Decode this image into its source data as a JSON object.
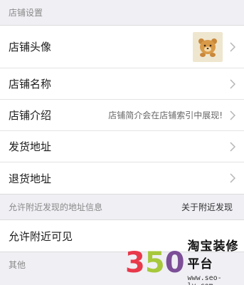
{
  "sections": {
    "store_settings": "店铺设置",
    "nearby_info": "允许附近发现的地址信息",
    "nearby_link": "关于附近发现",
    "other": "其他"
  },
  "rows": {
    "avatar": "店铺头像",
    "name": "店铺名称",
    "intro": "店铺介绍",
    "intro_hint": "店铺简介会在店铺索引中展现!",
    "ship_address": "发货地址",
    "return_address": "退货地址",
    "nearby_visible": "允许附近可见"
  },
  "watermark": {
    "digits": [
      "3",
      "5",
      "0"
    ],
    "title": "淘宝装修平台",
    "url": "www.seo-lv.com"
  },
  "icons": {
    "chevron": "chevron-right-icon",
    "avatar": "bear-avatar-icon"
  }
}
